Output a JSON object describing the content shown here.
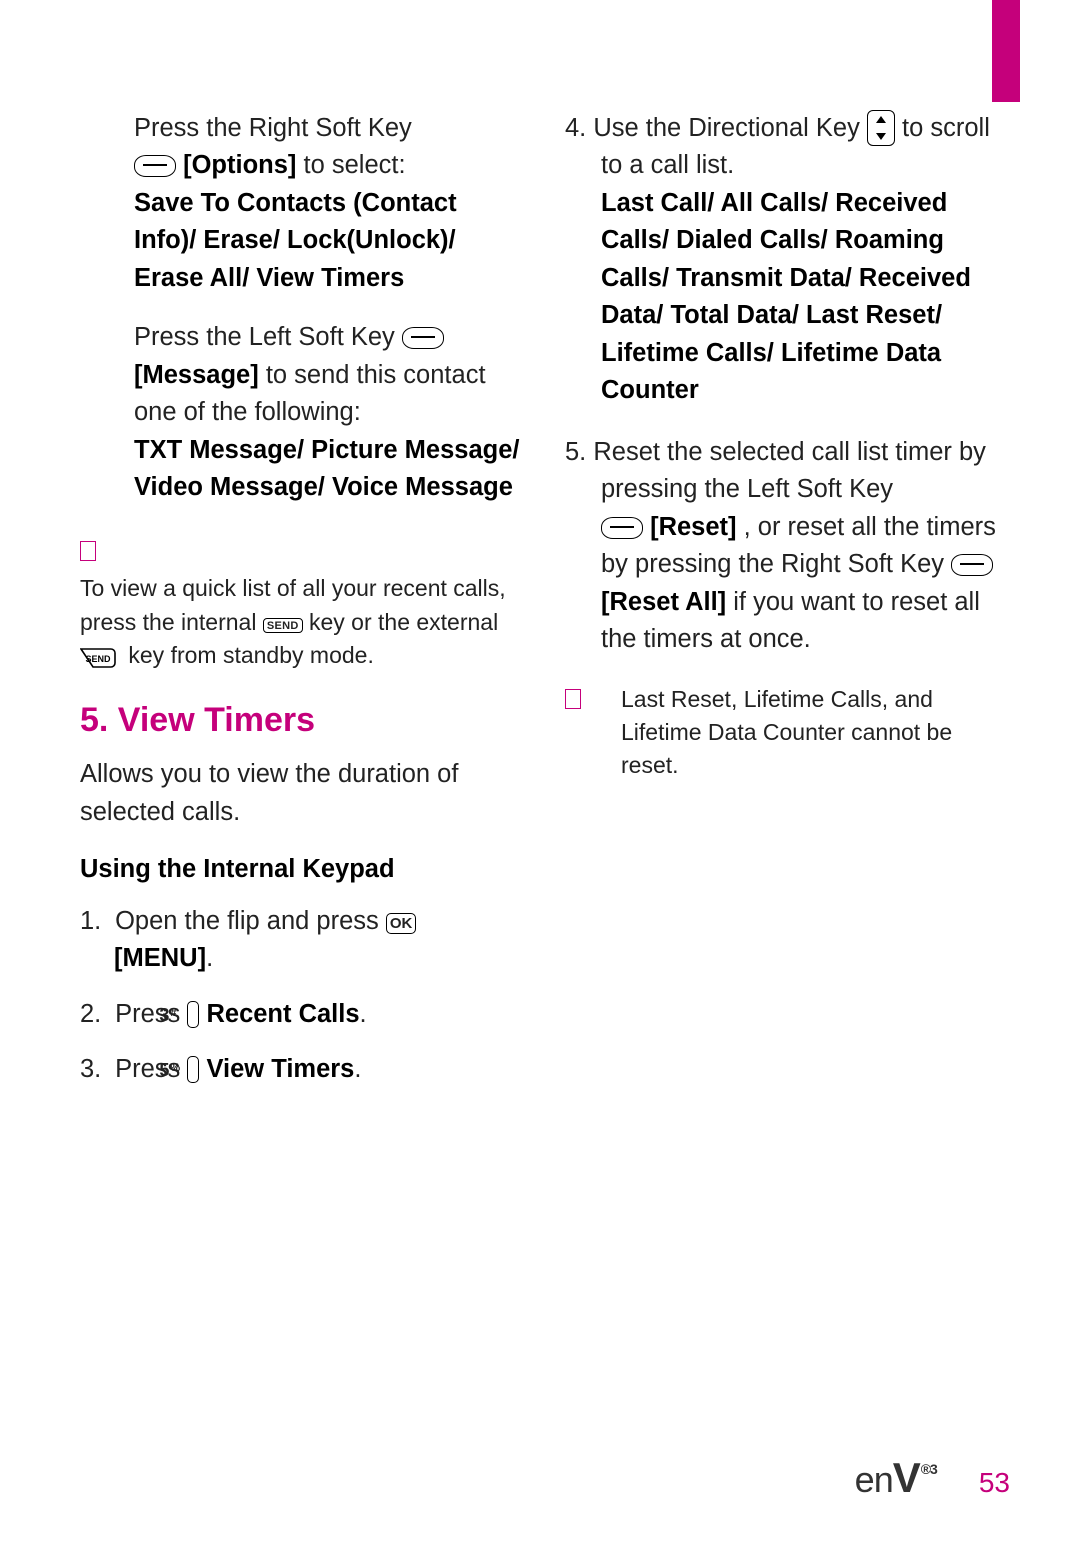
{
  "left": {
    "p1_a": "Press the Right Soft Key",
    "p1_opt": "[Options]",
    "p1_b": " to select:",
    "p1_bold": "Save To Contacts (Contact Info)/ Erase/ Lock(Unlock)/ Erase All/ View Timers",
    "p2_a": "Press the Left Soft Key ",
    "p2_msg": "[Message]",
    "p2_b": " to send this contact one of the following:",
    "p2_bold": "TXT Message/ Picture Message/ Video Message/ Voice Message",
    "note_a": "To view a quick list of all your recent calls, press the internal ",
    "note_send": "SEND",
    "note_b": " key or the external ",
    "note_c": " key from standby mode.",
    "heading": "5. View Timers",
    "desc": "Allows you to view the duration of selected calls.",
    "subhead": "Using the Internal Keypad",
    "s1_a": "Open the flip and press ",
    "s1_ok": "OK",
    "s1_menu": "[MENU]",
    "s1_dot": ".",
    "s2_a": "Press ",
    "s2_key": "3",
    "s2_keysup": "#",
    "s2_b": "Recent Calls",
    "s3_a": "Press ",
    "s3_key": "5",
    "s3_keysup": "%",
    "s3_b": "View Timers"
  },
  "right": {
    "s4_a": "Use the Directional Key ",
    "s4_b": " to scroll to a call list.",
    "s4_bold": "Last Call/ All Calls/ Received Calls/ Dialed Calls/ Roaming Calls/ Transmit Data/ Received Data/ Total Data/ Last Reset/ Lifetime Calls/ Lifetime Data Counter",
    "s5_a": "Reset the selected call list timer by pressing the Left Soft Key",
    "s5_reset": "[Reset]",
    "s5_b": ", or reset all the timers by pressing the Right Soft Key ",
    "s5_resetall": "[Reset All]",
    "s5_c": " if you want to reset all the timers at once.",
    "note": "Last Reset, Lifetime Calls, and Lifetime Data Counter cannot be reset."
  },
  "footer": {
    "page": "53"
  }
}
